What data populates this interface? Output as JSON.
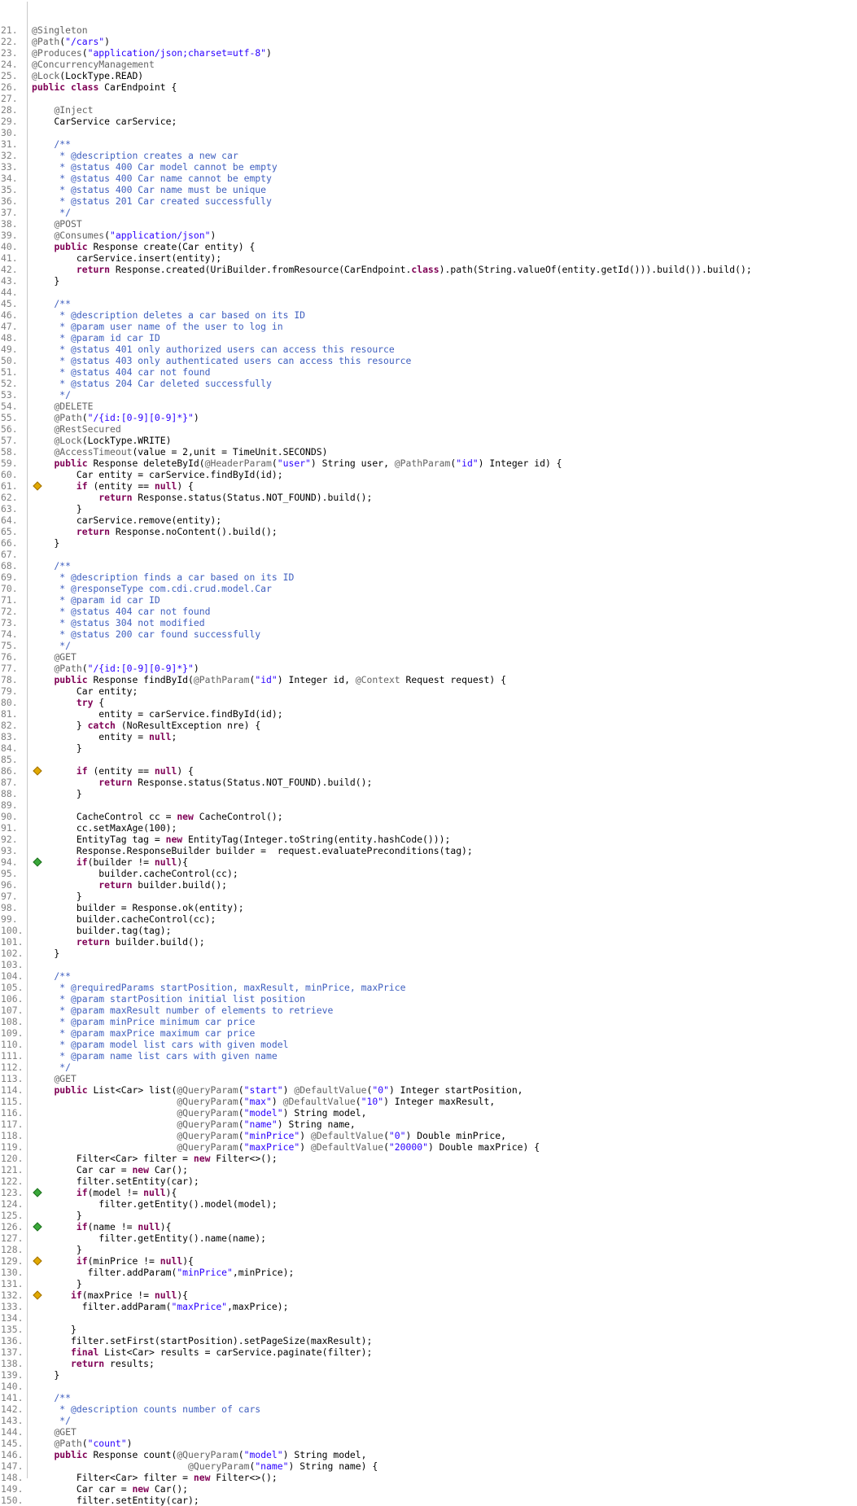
{
  "editor": {
    "file_type": "java",
    "lines": [
      {
        "n": "21.",
        "text": "@Singleton",
        "cov": ""
      },
      {
        "n": "22.",
        "text": "@Path(\"/cars\")",
        "cov": ""
      },
      {
        "n": "23.",
        "text": "@Produces(\"application/json;charset=utf-8\")",
        "cov": ""
      },
      {
        "n": "24.",
        "text": "@ConcurrencyManagement",
        "cov": ""
      },
      {
        "n": "25.",
        "text": "@Lock(LockType.READ)",
        "cov": ""
      },
      {
        "n": "26.",
        "text": "public class CarEndpoint {",
        "cov": "full"
      },
      {
        "n": "27.",
        "text": "",
        "cov": ""
      },
      {
        "n": "28.",
        "text": "    @Inject",
        "cov": ""
      },
      {
        "n": "29.",
        "text": "    CarService carService;",
        "cov": ""
      },
      {
        "n": "30.",
        "text": "",
        "cov": ""
      },
      {
        "n": "31.",
        "text": "    /**",
        "cov": ""
      },
      {
        "n": "32.",
        "text": "     * @description creates a new car",
        "cov": ""
      },
      {
        "n": "33.",
        "text": "     * @status 400 Car model cannot be empty",
        "cov": ""
      },
      {
        "n": "34.",
        "text": "     * @status 400 Car name cannot be empty",
        "cov": ""
      },
      {
        "n": "35.",
        "text": "     * @status 400 Car name must be unique",
        "cov": ""
      },
      {
        "n": "36.",
        "text": "     * @status 201 Car created successfully",
        "cov": ""
      },
      {
        "n": "37.",
        "text": "     */",
        "cov": ""
      },
      {
        "n": "38.",
        "text": "    @POST",
        "cov": ""
      },
      {
        "n": "39.",
        "text": "    @Consumes(\"application/json\")",
        "cov": ""
      },
      {
        "n": "40.",
        "text": "    public Response create(Car entity) {",
        "cov": ""
      },
      {
        "n": "41.",
        "text": "        carService.insert(entity);",
        "cov": "full",
        "band": "full"
      },
      {
        "n": "42.",
        "text": "        return Response.created(UriBuilder.fromResource(CarEndpoint.class).path(String.valueOf(entity.getId())).build()).build();",
        "cov": "full",
        "band": "full"
      },
      {
        "n": "43.",
        "text": "    }",
        "cov": ""
      },
      {
        "n": "44.",
        "text": "",
        "cov": ""
      },
      {
        "n": "45.",
        "text": "    /**",
        "cov": ""
      },
      {
        "n": "46.",
        "text": "     * @description deletes a car based on its ID",
        "cov": ""
      },
      {
        "n": "47.",
        "text": "     * @param user name of the user to log in",
        "cov": ""
      },
      {
        "n": "48.",
        "text": "     * @param id car ID",
        "cov": ""
      },
      {
        "n": "49.",
        "text": "     * @status 401 only authorized users can access this resource",
        "cov": ""
      },
      {
        "n": "50.",
        "text": "     * @status 403 only authenticated users can access this resource",
        "cov": ""
      },
      {
        "n": "51.",
        "text": "     * @status 404 car not found",
        "cov": ""
      },
      {
        "n": "52.",
        "text": "     * @status 204 Car deleted successfully",
        "cov": ""
      },
      {
        "n": "53.",
        "text": "     */",
        "cov": ""
      },
      {
        "n": "54.",
        "text": "    @DELETE",
        "cov": ""
      },
      {
        "n": "55.",
        "text": "    @Path(\"/{id:[0-9][0-9]*}\")",
        "cov": ""
      },
      {
        "n": "56.",
        "text": "    @RestSecured",
        "cov": ""
      },
      {
        "n": "57.",
        "text": "    @Lock(LockType.WRITE)",
        "cov": ""
      },
      {
        "n": "58.",
        "text": "    @AccessTimeout(value = 2,unit = TimeUnit.SECONDS)",
        "cov": ""
      },
      {
        "n": "59.",
        "text": "    public Response deleteById(@HeaderParam(\"user\") String user, @PathParam(\"id\") Integer id) {",
        "cov": ""
      },
      {
        "n": "60.",
        "text": "        Car entity = carService.findById(id);",
        "cov": "full",
        "band": "full"
      },
      {
        "n": "61.",
        "text": "        if (entity == null) {",
        "cov": "part",
        "band": "part",
        "marker": "yellow"
      },
      {
        "n": "62.",
        "text": "            return Response.status(Status.NOT_FOUND).build();",
        "cov": "none",
        "band": "none"
      },
      {
        "n": "63.",
        "text": "        }",
        "cov": "full",
        "band": "full"
      },
      {
        "n": "64.",
        "text": "        carService.remove(entity);",
        "cov": "full",
        "band": "full"
      },
      {
        "n": "65.",
        "text": "        return Response.noContent().build();",
        "cov": "full",
        "band": "full"
      },
      {
        "n": "66.",
        "text": "    }",
        "cov": ""
      },
      {
        "n": "67.",
        "text": "",
        "cov": ""
      },
      {
        "n": "68.",
        "text": "    /**",
        "cov": ""
      },
      {
        "n": "69.",
        "text": "     * @description finds a car based on its ID",
        "cov": ""
      },
      {
        "n": "70.",
        "text": "     * @responseType com.cdi.crud.model.Car",
        "cov": ""
      },
      {
        "n": "71.",
        "text": "     * @param id car ID",
        "cov": ""
      },
      {
        "n": "72.",
        "text": "     * @status 404 car not found",
        "cov": ""
      },
      {
        "n": "73.",
        "text": "     * @status 304 not modified",
        "cov": ""
      },
      {
        "n": "74.",
        "text": "     * @status 200 car found successfully",
        "cov": ""
      },
      {
        "n": "75.",
        "text": "     */",
        "cov": ""
      },
      {
        "n": "76.",
        "text": "    @GET",
        "cov": ""
      },
      {
        "n": "77.",
        "text": "    @Path(\"/{id:[0-9][0-9]*}\")",
        "cov": ""
      },
      {
        "n": "78.",
        "text": "    public Response findById(@PathParam(\"id\") Integer id, @Context Request request) {",
        "cov": ""
      },
      {
        "n": "79.",
        "text": "        Car entity;",
        "cov": ""
      },
      {
        "n": "80.",
        "text": "        try {",
        "cov": ""
      },
      {
        "n": "81.",
        "text": "            entity = carService.findById(id);",
        "cov": "full",
        "band": "full"
      },
      {
        "n": "82.",
        "text": "        } catch (NoResultException nre) {",
        "cov": "none",
        "band": "none"
      },
      {
        "n": "83.",
        "text": "            entity = null;",
        "cov": "none",
        "band": "none"
      },
      {
        "n": "84.",
        "text": "        }",
        "cov": "full",
        "band": "full"
      },
      {
        "n": "85.",
        "text": "",
        "cov": ""
      },
      {
        "n": "86.",
        "text": "        if (entity == null) {",
        "cov": "part",
        "band": "part",
        "marker": "yellow"
      },
      {
        "n": "87.",
        "text": "            return Response.status(Status.NOT_FOUND).build();",
        "cov": "none",
        "band": "none"
      },
      {
        "n": "88.",
        "text": "        }",
        "cov": "full",
        "band": "full"
      },
      {
        "n": "89.",
        "text": "",
        "cov": ""
      },
      {
        "n": "90.",
        "text": "        CacheControl cc = new CacheControl();",
        "cov": "full",
        "band": "full"
      },
      {
        "n": "91.",
        "text": "        cc.setMaxAge(100);",
        "cov": "full",
        "band": "full"
      },
      {
        "n": "92.",
        "text": "        EntityTag tag = new EntityTag(Integer.toString(entity.hashCode()));",
        "cov": "full",
        "band": "full"
      },
      {
        "n": "93.",
        "text": "        Response.ResponseBuilder builder =  request.evaluatePreconditions(tag);",
        "cov": "full",
        "band": "full"
      },
      {
        "n": "94.",
        "text": "        if(builder != null){",
        "cov": "full",
        "band": "full",
        "marker": "green"
      },
      {
        "n": "95.",
        "text": "            builder.cacheControl(cc);",
        "cov": "full",
        "band": "full"
      },
      {
        "n": "96.",
        "text": "            return builder.build();",
        "cov": "full",
        "band": "full"
      },
      {
        "n": "97.",
        "text": "        }",
        "cov": "full",
        "band": "full"
      },
      {
        "n": "98.",
        "text": "        builder = Response.ok(entity);",
        "cov": "full",
        "band": "full"
      },
      {
        "n": "99.",
        "text": "        builder.cacheControl(cc);",
        "cov": "full",
        "band": "full"
      },
      {
        "n": "100.",
        "text": "        builder.tag(tag);",
        "cov": "full",
        "band": "full"
      },
      {
        "n": "101.",
        "text": "        return builder.build();",
        "cov": "full",
        "band": "full"
      },
      {
        "n": "102.",
        "text": "    }",
        "cov": ""
      },
      {
        "n": "103.",
        "text": "",
        "cov": ""
      },
      {
        "n": "104.",
        "text": "    /**",
        "cov": ""
      },
      {
        "n": "105.",
        "text": "     * @requiredParams startPosition, maxResult, minPrice, maxPrice",
        "cov": ""
      },
      {
        "n": "106.",
        "text": "     * @param startPosition initial list position",
        "cov": ""
      },
      {
        "n": "107.",
        "text": "     * @param maxResult number of elements to retrieve",
        "cov": ""
      },
      {
        "n": "108.",
        "text": "     * @param minPrice minimum car price",
        "cov": ""
      },
      {
        "n": "109.",
        "text": "     * @param maxPrice maximum car price",
        "cov": ""
      },
      {
        "n": "110.",
        "text": "     * @param model list cars with given model",
        "cov": ""
      },
      {
        "n": "111.",
        "text": "     * @param name list cars with given name",
        "cov": ""
      },
      {
        "n": "112.",
        "text": "     */",
        "cov": ""
      },
      {
        "n": "113.",
        "text": "    @GET",
        "cov": ""
      },
      {
        "n": "114.",
        "text": "    public List<Car> list(@QueryParam(\"start\") @DefaultValue(\"0\") Integer startPosition,",
        "cov": ""
      },
      {
        "n": "115.",
        "text": "                          @QueryParam(\"max\") @DefaultValue(\"10\") Integer maxResult,",
        "cov": ""
      },
      {
        "n": "116.",
        "text": "                          @QueryParam(\"model\") String model,",
        "cov": ""
      },
      {
        "n": "117.",
        "text": "                          @QueryParam(\"name\") String name,",
        "cov": ""
      },
      {
        "n": "118.",
        "text": "                          @QueryParam(\"minPrice\") @DefaultValue(\"0\") Double minPrice,",
        "cov": ""
      },
      {
        "n": "119.",
        "text": "                          @QueryParam(\"maxPrice\") @DefaultValue(\"20000\") Double maxPrice) {",
        "cov": ""
      },
      {
        "n": "120.",
        "text": "        Filter<Car> filter = new Filter<>();",
        "cov": "full",
        "band": "full"
      },
      {
        "n": "121.",
        "text": "        Car car = new Car();",
        "cov": "full",
        "band": "full"
      },
      {
        "n": "122.",
        "text": "        filter.setEntity(car);",
        "cov": "full",
        "band": "full"
      },
      {
        "n": "123.",
        "text": "        if(model != null){",
        "cov": "full",
        "band": "full",
        "marker": "green"
      },
      {
        "n": "124.",
        "text": "            filter.getEntity().model(model);",
        "cov": "full",
        "band": "full"
      },
      {
        "n": "125.",
        "text": "        }",
        "cov": "full",
        "band": "full"
      },
      {
        "n": "126.",
        "text": "        if(name != null){",
        "cov": "full",
        "band": "full",
        "marker": "green"
      },
      {
        "n": "127.",
        "text": "            filter.getEntity().name(name);",
        "cov": "full",
        "band": "full"
      },
      {
        "n": "128.",
        "text": "        }",
        "cov": "full",
        "band": "full"
      },
      {
        "n": "129.",
        "text": "        if(minPrice != null){",
        "cov": "part",
        "band": "part",
        "marker": "yellow"
      },
      {
        "n": "130.",
        "text": "          filter.addParam(\"minPrice\",minPrice);",
        "cov": "full",
        "band": "full"
      },
      {
        "n": "131.",
        "text": "        }",
        "cov": "full",
        "band": "full"
      },
      {
        "n": "132.",
        "text": "       if(maxPrice != null){",
        "cov": "part",
        "band": "part",
        "marker": "yellow"
      },
      {
        "n": "133.",
        "text": "         filter.addParam(\"maxPrice\",maxPrice);",
        "cov": "full",
        "band": "full"
      },
      {
        "n": "134.",
        "text": "",
        "cov": ""
      },
      {
        "n": "135.",
        "text": "       }",
        "cov": "full",
        "band": "full"
      },
      {
        "n": "136.",
        "text": "       filter.setFirst(startPosition).setPageSize(maxResult);",
        "cov": "full",
        "band": "full"
      },
      {
        "n": "137.",
        "text": "       final List<Car> results = carService.paginate(filter);",
        "cov": "full",
        "band": "full"
      },
      {
        "n": "138.",
        "text": "       return results;",
        "cov": "full",
        "band": "full"
      },
      {
        "n": "139.",
        "text": "    }",
        "cov": ""
      },
      {
        "n": "140.",
        "text": "",
        "cov": ""
      },
      {
        "n": "141.",
        "text": "    /**",
        "cov": ""
      },
      {
        "n": "142.",
        "text": "     * @description counts number of cars",
        "cov": ""
      },
      {
        "n": "143.",
        "text": "     */",
        "cov": ""
      },
      {
        "n": "144.",
        "text": "    @GET",
        "cov": ""
      },
      {
        "n": "145.",
        "text": "    @Path(\"count\")",
        "cov": ""
      },
      {
        "n": "146.",
        "text": "    public Response count(@QueryParam(\"model\") String model,",
        "cov": ""
      },
      {
        "n": "147.",
        "text": "                            @QueryParam(\"name\") String name) {",
        "cov": ""
      },
      {
        "n": "148.",
        "text": "        Filter<Car> filter = new Filter<>();",
        "cov": "full",
        "band": "full"
      },
      {
        "n": "149.",
        "text": "        Car car = new Car();",
        "cov": "full",
        "band": "full"
      },
      {
        "n": "150.",
        "text": "        filter.setEntity(car);",
        "cov": "full",
        "band": "full"
      }
    ]
  },
  "colors": {
    "covered": "#c8f5c0",
    "partial": "#fffdc2",
    "missed": "#f8aaaa",
    "keyword": "#7f0055",
    "string": "#2a00ff",
    "comment": "#3f5fbf",
    "line_number": "#808080"
  }
}
